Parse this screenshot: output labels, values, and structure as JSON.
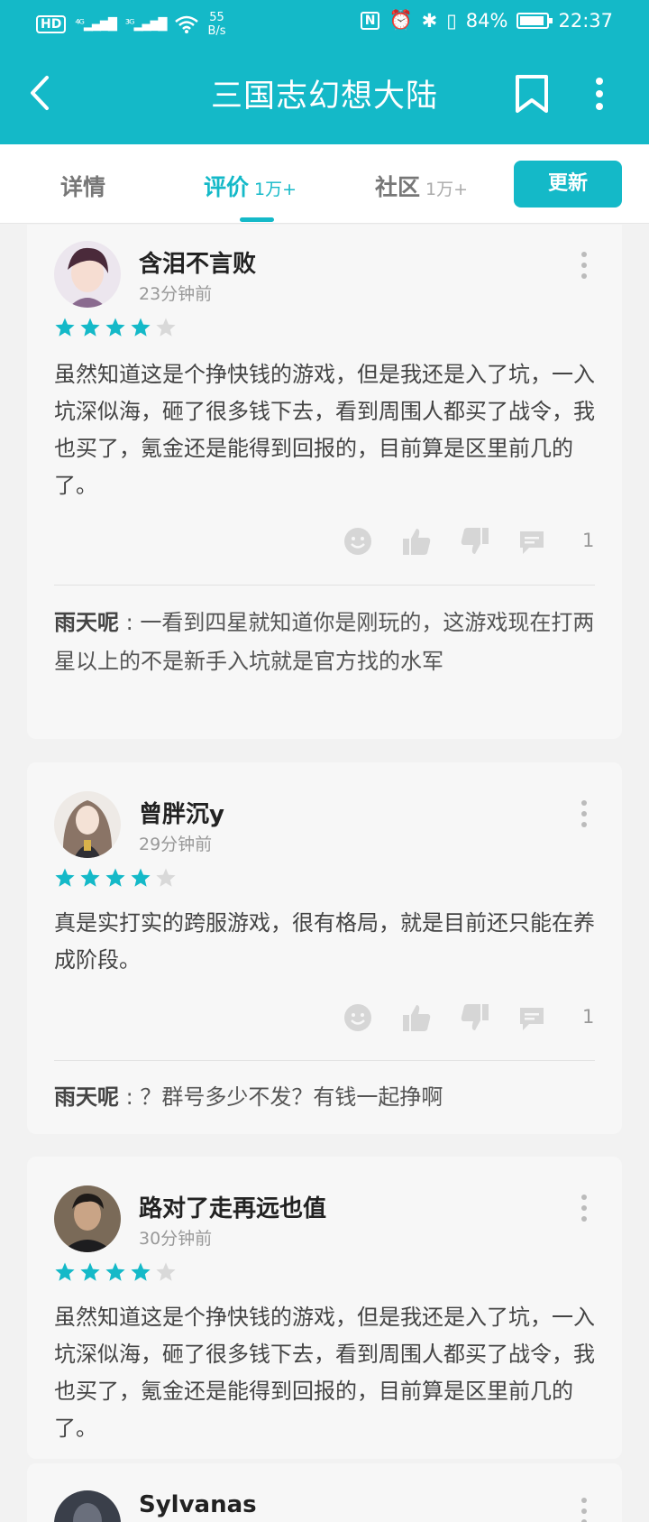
{
  "status_bar": {
    "left_icons": [
      "hd-icon",
      "4g-signal-icon",
      "3g-signal-icon",
      "wifi-icon"
    ],
    "net_speed_value": "55",
    "net_speed_unit": "B/s",
    "battery": "84%",
    "time": "22:37"
  },
  "header": {
    "title": "三国志幻想大陆"
  },
  "tabs": [
    {
      "label": "详情",
      "count": ""
    },
    {
      "label": "评价",
      "count": "1万+"
    },
    {
      "label": "社区",
      "count": "1万+"
    }
  ],
  "update_button": "更新",
  "reviews": [
    {
      "user": "含泪不言败",
      "time": "23分钟前",
      "rating": 4,
      "text": "虽然知道这是个挣快钱的游戏，但是我还是入了坑，一入坑深似海，砸了很多钱下去，看到周围人都买了战令，我也买了，氪金还是能得到回报的，目前算是区里前几的了。",
      "comment_count": "1",
      "reply_user": "雨天呢",
      "reply_text": "一看到四星就知道你是刚玩的，这游戏现在打两星以上的不是新手入坑就是官方找的水军"
    },
    {
      "user": "曾胖沉y",
      "time": "29分钟前",
      "rating": 4,
      "text": "真是实打实的跨服游戏，很有格局，就是目前还只能在养成阶段。",
      "comment_count": "1",
      "reply_user": "雨天呢",
      "reply_text": "？群号多少不发？有钱一起挣啊"
    },
    {
      "user": "路对了走再远也值",
      "time": "30分钟前",
      "rating": 4,
      "text": "虽然知道这是个挣快钱的游戏，但是我还是入了坑，一入坑深似海，砸了很多钱下去，看到周围人都买了战令，我也买了，氪金还是能得到回报的，目前算是区里前几的了。"
    },
    {
      "user": "Sylvanas"
    }
  ],
  "colors": {
    "accent": "#14b9c8",
    "star_empty": "#d9d9d9",
    "card_bg": "#f7f7f7"
  }
}
